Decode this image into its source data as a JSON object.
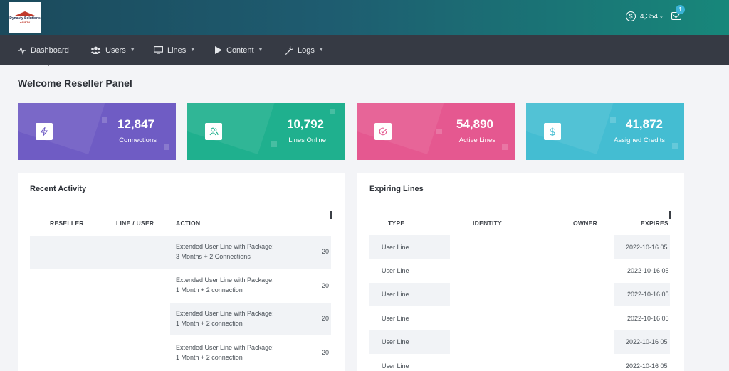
{
  "header": {
    "logo": {
      "line1": "Dynasty Solutions",
      "line2": "e4 IPTV"
    },
    "credits": "4,354",
    "notifications_count": "1"
  },
  "nav": {
    "items": [
      {
        "label": "Dashboard",
        "icon": "activity-icon"
      },
      {
        "label": "Users",
        "icon": "users-icon"
      },
      {
        "label": "Lines",
        "icon": "monitor-icon"
      },
      {
        "label": "Content",
        "icon": "play-icon"
      },
      {
        "label": "Logs",
        "icon": "wrench-icon"
      }
    ]
  },
  "page": {
    "title": "Welcome Reseller Panel"
  },
  "stats": [
    {
      "value": "12,847",
      "label": "Connections",
      "color": "#6f5cc4",
      "icon": "zap-icon"
    },
    {
      "value": "10,792",
      "label": "Lines Online",
      "color": "#1fb08e",
      "icon": "users-icon"
    },
    {
      "value": "54,890",
      "label": "Active Lines",
      "color": "#e55890",
      "icon": "check-circle-icon"
    },
    {
      "value": "41,872",
      "label": "Assigned Credits",
      "color": "#44bdd2",
      "icon": "dollar-icon"
    }
  ],
  "recent_activity": {
    "title": "Recent Activity",
    "columns": [
      "RESELLER",
      "LINE / USER",
      "ACTION"
    ],
    "rows": [
      {
        "action_line1": "Extended User Line with Package:",
        "action_line2": "3 Months + 2 Connections",
        "date": "20"
      },
      {
        "action_line1": "Extended User Line with Package:",
        "action_line2": "1 Month + 2 connection",
        "date": "20"
      },
      {
        "action_line1": "Extended User Line with Package:",
        "action_line2": "1 Month + 2 connection",
        "date": "20"
      },
      {
        "action_line1": "Extended User Line with Package:",
        "action_line2": "1 Month + 2 connection",
        "date": "20"
      }
    ]
  },
  "expiring_lines": {
    "title": "Expiring Lines",
    "columns": [
      "TYPE",
      "IDENTITY",
      "OWNER",
      "EXPIRES"
    ],
    "rows": [
      {
        "type": "User Line",
        "expires": "2022-10-16 05"
      },
      {
        "type": "User Line",
        "expires": "2022-10-16 05"
      },
      {
        "type": "User Line",
        "expires": "2022-10-16 05"
      },
      {
        "type": "User Line",
        "expires": "2022-10-16 05"
      },
      {
        "type": "User Line",
        "expires": "2022-10-16 05"
      },
      {
        "type": "User Line",
        "expires": "2022-10-16 05"
      }
    ]
  }
}
